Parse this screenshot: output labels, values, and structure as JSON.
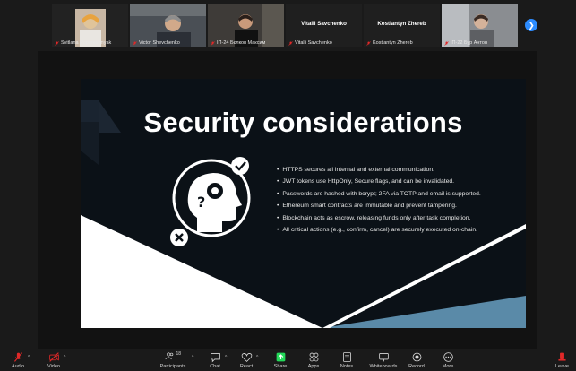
{
  "gallery": {
    "participants": [
      {
        "name": "Svitlana Popereshnyak",
        "video": true,
        "muted": true,
        "active": false
      },
      {
        "name": "Victor Shevchenko",
        "video": true,
        "muted": true,
        "active": false
      },
      {
        "name": "ІП-24 Бєлков Максим",
        "video": true,
        "muted": true,
        "active": true
      },
      {
        "name": "Vitalii Savchenko",
        "video": false,
        "muted": true,
        "active": false
      },
      {
        "name": "Kostiantyn Zhereb",
        "video": false,
        "muted": true,
        "active": false,
        "display_name": "Kostiantyn Zhere..."
      },
      {
        "name": "ІП-22 Бур Антон",
        "video": true,
        "muted": true,
        "active": false
      }
    ],
    "center_names": {
      "t4": "Vitalii Savchenko",
      "t5": "Kostiantyn  Zhereb"
    }
  },
  "slide": {
    "title": "Security considerations",
    "bullets": [
      "HTTPS secures all internal and external communication.",
      "JWT tokens use HttpOnly, Secure flags, and can be invalidated.",
      "Passwords are hashed with bcrypt; 2FA via TOTP and email is supported.",
      "Ethereum smart contracts are immutable and prevent tampering.",
      "Blockchain acts as escrow, releasing funds only after task completion.",
      "All critical actions (e.g., confirm, cancel) are securely executed on-chain."
    ]
  },
  "toolbar": {
    "audio": "Audio",
    "video": "Video",
    "participants": "Participants",
    "participants_count": "18",
    "chat": "Chat",
    "react": "React",
    "share": "Share",
    "apps": "Apps",
    "notes": "Notes",
    "whiteboards": "Whiteboards",
    "record": "Record",
    "more": "More",
    "leave": "Leave"
  },
  "colors": {
    "active_border": "#23d959",
    "share_green": "#23d959",
    "mute_red": "#e02828",
    "leave_red": "#e02828",
    "accent_blue": "#2d8cff"
  }
}
